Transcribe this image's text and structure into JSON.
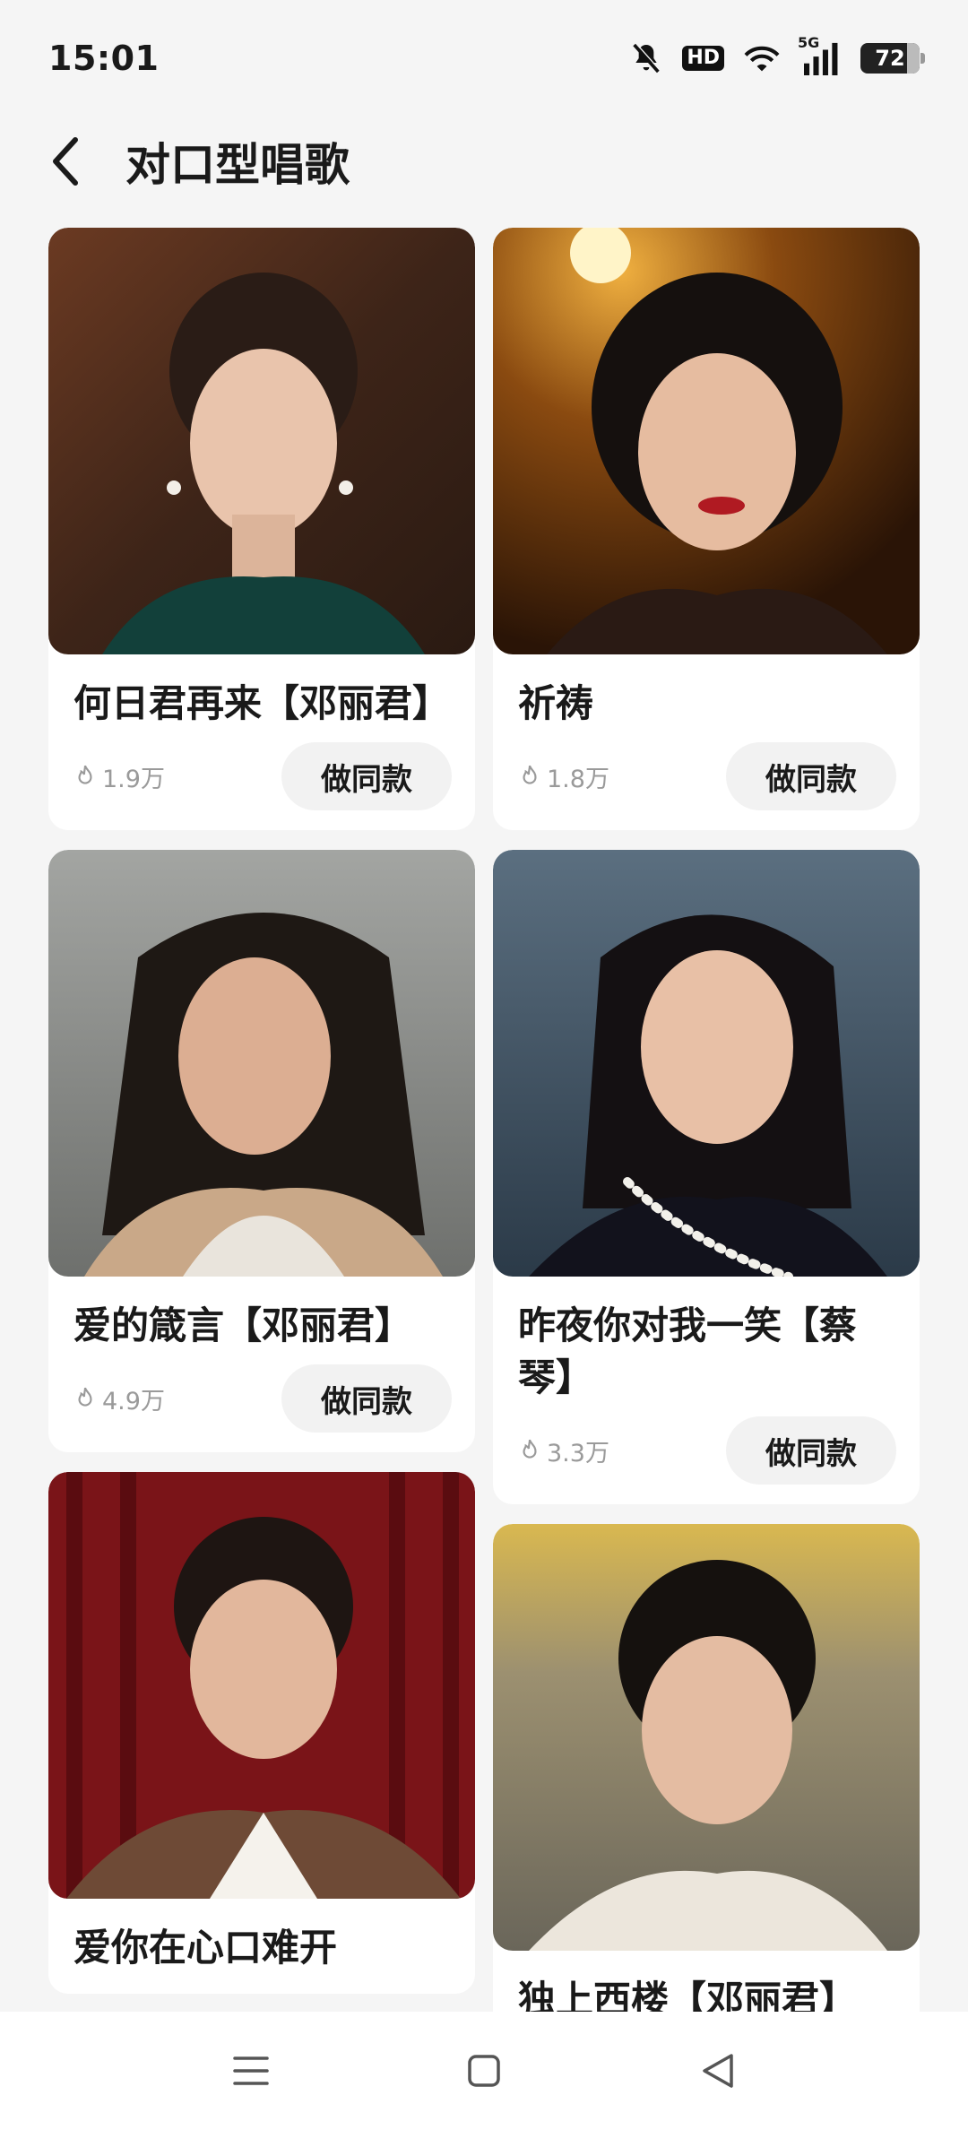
{
  "status_bar": {
    "time": "15:01",
    "battery": "72",
    "hd_label": "HD",
    "network_label": "5G"
  },
  "header": {
    "title": "对口型唱歌"
  },
  "buttons": {
    "make_same": "做同款"
  },
  "cards_left": [
    {
      "title": "何日君再来【邓丽君】",
      "likes": "1.9万",
      "bg": "#3d2a1e"
    },
    {
      "title": "爱的箴言【邓丽君】",
      "likes": "4.9万",
      "bg": "#8e8f8c"
    },
    {
      "title": "爱你在心口难开",
      "likes": "",
      "bg": "#7a1418"
    }
  ],
  "cards_right": [
    {
      "title": "祈祷",
      "likes": "1.8万",
      "bg": "#5a3008"
    },
    {
      "title": "昨夜你对我一笑【蔡琴】",
      "likes": "3.3万",
      "bg": "#3d5060"
    },
    {
      "title": "独上西楼【邓丽君】",
      "likes": "",
      "bg": "#9a8a58"
    }
  ],
  "colors": {
    "background": "#f5f5f5",
    "card": "#ffffff",
    "button_bg": "#f2f2f2",
    "meta_text": "#9a9a9a"
  }
}
